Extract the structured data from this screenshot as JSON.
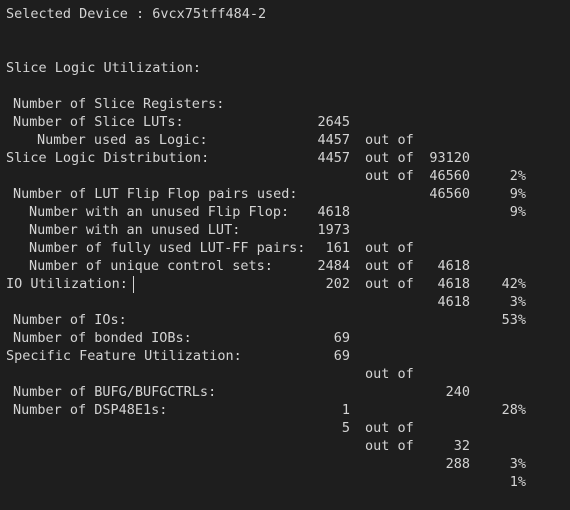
{
  "device": {
    "text": "Selected Device : 6vcx75tff484-2"
  },
  "sections": {
    "slice_logic_utilization": {
      "header": "Slice Logic Utilization:",
      "rows": [
        {
          "label": "Number of Slice Registers:",
          "used": "2645",
          "out_of": "out of",
          "available": "93120",
          "percent": "2%"
        },
        {
          "label": "Number of Slice LUTs:",
          "used": "4457",
          "out_of": "out of",
          "available": "46560",
          "percent": "9%"
        },
        {
          "label": "Number used as Logic:",
          "used": "4457",
          "out_of": "out of",
          "available": "46560",
          "percent": "9%"
        }
      ]
    },
    "slice_logic_distribution": {
      "header": "Slice Logic Distribution:",
      "rows": [
        {
          "label": "Number of LUT Flip Flop pairs used:",
          "used": "4618"
        },
        {
          "label": "Number with an unused Flip Flop:",
          "used": "1973",
          "out_of": "out of",
          "available": "4618",
          "percent": "42%"
        },
        {
          "label": "Number with an unused LUT:",
          "used": "161",
          "out_of": "out of",
          "available": "4618",
          "percent": "3%"
        },
        {
          "label": "Number of fully used LUT-FF pairs:",
          "used": "2484",
          "out_of": "out of",
          "available": "4618",
          "percent": "53%"
        },
        {
          "label": "Number of unique control sets:",
          "used": "202"
        }
      ]
    },
    "io_utilization": {
      "header": "IO Utilization:",
      "rows": [
        {
          "label": "Number of IOs:",
          "used": "69"
        },
        {
          "label": "Number of bonded IOBs:",
          "used": "69",
          "out_of": "out of",
          "available": "240",
          "percent": "28%"
        }
      ]
    },
    "specific_feature_utilization": {
      "header": "Specific Feature Utilization:",
      "rows": [
        {
          "label": "Number of BUFG/BUFGCTRLs:",
          "used": "1",
          "out_of": "out of",
          "available": "32",
          "percent": "3%"
        },
        {
          "label": "Number of DSP48E1s:",
          "used": "5",
          "out_of": "out of",
          "available": "288",
          "percent": "1%"
        }
      ]
    }
  }
}
